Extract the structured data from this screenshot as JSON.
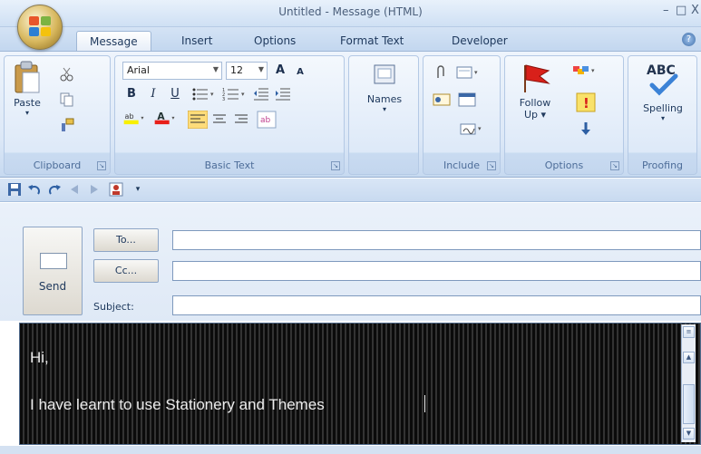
{
  "window": {
    "title": "Untitled - Message (HTML)",
    "minimize": "–",
    "maximize": "□",
    "close": "X"
  },
  "tabs": [
    {
      "label": "Message",
      "active": true
    },
    {
      "label": "Insert"
    },
    {
      "label": "Options"
    },
    {
      "label": "Format Text"
    },
    {
      "label": "Developer"
    }
  ],
  "help": "?",
  "ribbon": {
    "clipboard": {
      "paste": "Paste",
      "label": "Clipboard"
    },
    "basic_text": {
      "font": "Arial",
      "size": "12",
      "grow": "A",
      "shrink": "A",
      "bold": "B",
      "italic": "I",
      "underline": "U",
      "label": "Basic Text"
    },
    "names": {
      "label": "Names"
    },
    "include": {
      "label": "Include"
    },
    "options": {
      "follow_up": "Follow",
      "follow_up2": "Up",
      "label": "Options"
    },
    "proofing": {
      "abc": "ABC",
      "spelling": "Spelling",
      "label": "Proofing"
    }
  },
  "header": {
    "send": "Send",
    "to_button": "To...",
    "cc_button": "Cc...",
    "subject_label": "Subject:",
    "to_value": "",
    "cc_value": "",
    "subject_value": ""
  },
  "body": {
    "line1": "Hi,",
    "line2": "I have learnt to use Stationery and Themes"
  },
  "colors": {
    "accent": "#1e395b",
    "ribbon": "#dce8f7",
    "body_background": "#0b0b0b"
  }
}
